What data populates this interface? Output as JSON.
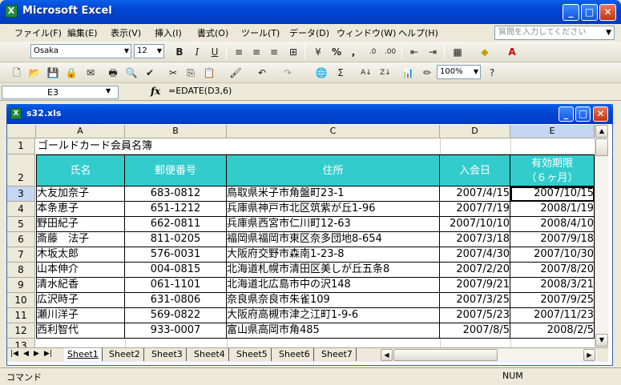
{
  "app": {
    "title": "Microsoft Excel",
    "icon_label": "X",
    "window_buttons": [
      "_",
      "□",
      "✕"
    ]
  },
  "menu": {
    "items": [
      "ファイル(F)",
      "編集(E)",
      "表示(V)",
      "挿入(I)",
      "書式(O)",
      "ツール(T)",
      "データ(D)",
      "ウィンドウ(W)",
      "ヘルプ(H)"
    ],
    "help_placeholder": "質問を入力してください"
  },
  "toolbar": {
    "font_name": "Osaka",
    "font_size": "12",
    "bold": "B",
    "italic": "I",
    "underline": "U",
    "percent": "%",
    "comma": ",",
    "zoom": "100%"
  },
  "formula_bar": {
    "name_box": "E3",
    "fx": "fx",
    "formula": "=EDATE(D3,6)"
  },
  "workbook": {
    "title": "s32.xls",
    "icon_label": "X"
  },
  "sheet": {
    "columns": [
      "A",
      "B",
      "C",
      "D",
      "E"
    ],
    "selected_column": "E",
    "title_cell": "ゴールドカード会員名簿",
    "headers": [
      "氏名",
      "郵便番号",
      "住所",
      "入会日",
      "有効期限",
      "（６ヶ月）"
    ],
    "rows": [
      {
        "num": "3",
        "name": "大友加奈子",
        "zip": "683-0812",
        "addr": "鳥取県米子市角盤町23-1",
        "joined": "2007/4/15",
        "expiry": "2007/10/15"
      },
      {
        "num": "4",
        "name": "本条恵子",
        "zip": "651-1212",
        "addr": "兵庫県神戸市北区筑紫が丘1-96",
        "joined": "2007/7/19",
        "expiry": "2008/1/19"
      },
      {
        "num": "5",
        "name": "野田紀子",
        "zip": "662-0811",
        "addr": "兵庫県西宮市仁川町12-63",
        "joined": "2007/10/10",
        "expiry": "2008/4/10"
      },
      {
        "num": "6",
        "name": "斎藤　法子",
        "zip": "811-0205",
        "addr": "福岡県福岡市東区奈多団地8-654",
        "joined": "2007/3/18",
        "expiry": "2007/9/18"
      },
      {
        "num": "7",
        "name": "木坂太郎",
        "zip": "576-0031",
        "addr": "大阪府交野市森南1-23-8",
        "joined": "2007/4/30",
        "expiry": "2007/10/30"
      },
      {
        "num": "8",
        "name": "山本伸介",
        "zip": "004-0815",
        "addr": "北海道札幌市清田区美しが丘五条8",
        "joined": "2007/2/20",
        "expiry": "2007/8/20"
      },
      {
        "num": "9",
        "name": "清水紀香",
        "zip": "061-1101",
        "addr": "北海道北広島市中の沢148",
        "joined": "2007/9/21",
        "expiry": "2008/3/21"
      },
      {
        "num": "10",
        "name": "広沢時子",
        "zip": "631-0806",
        "addr": "奈良県奈良市朱雀109",
        "joined": "2007/3/25",
        "expiry": "2007/9/25"
      },
      {
        "num": "11",
        "name": "瀬川洋子",
        "zip": "569-0822",
        "addr": "大阪府高槻市津之江町1-9-6",
        "joined": "2007/5/23",
        "expiry": "2007/11/23"
      },
      {
        "num": "12",
        "name": "西利智代",
        "zip": "933-0007",
        "addr": "富山県高岡市角485",
        "joined": "2007/8/5",
        "expiry": "2008/2/5"
      }
    ],
    "row_numbers_extra": [
      "1",
      "2",
      "13"
    ]
  },
  "sheet_tabs": [
    "Sheet1",
    "Sheet2",
    "Sheet3",
    "Sheet4",
    "Sheet5",
    "Sheet6",
    "Sheet7"
  ],
  "status": {
    "mode": "コマンド",
    "num": "NUM"
  }
}
